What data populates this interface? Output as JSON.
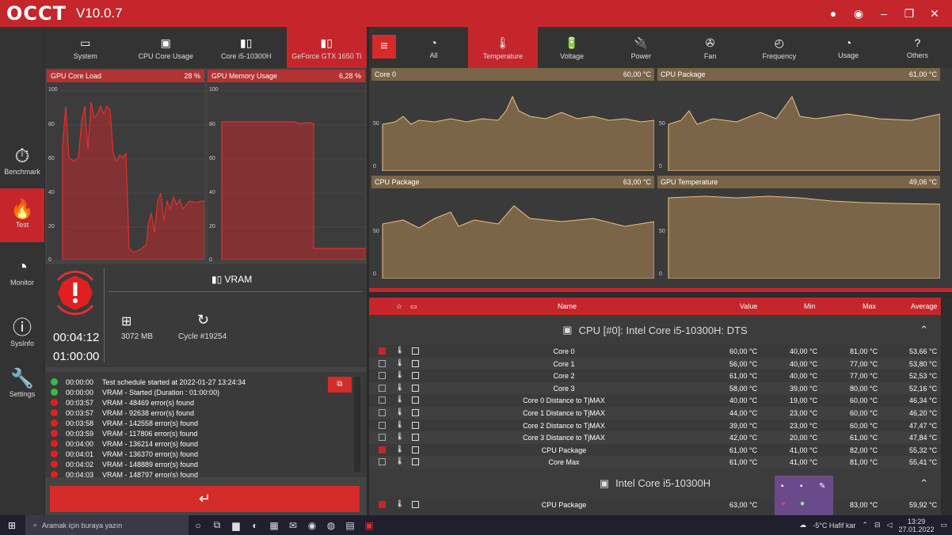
{
  "app": {
    "logo": "OCCT",
    "version": "V10.0.7"
  },
  "window_controls": {
    "info": "●",
    "camera": "◉",
    "minimize": "–",
    "maximize": "❐",
    "close": "✕"
  },
  "nav": [
    {
      "label": "Benchmark",
      "icon": "stopwatch-icon"
    },
    {
      "label": "Test",
      "icon": "flame-icon"
    },
    {
      "label": "Monitor",
      "icon": "gauge-icon"
    },
    {
      "label": "SysInfo",
      "icon": "info-icon"
    },
    {
      "label": "Settings",
      "icon": "wrench-icon"
    }
  ],
  "device_tabs": [
    {
      "label": "System"
    },
    {
      "label": "CPU Core Usage"
    },
    {
      "label": "Core i5-10300H"
    },
    {
      "label": "GeForce GTX 1650 Ti"
    }
  ],
  "gpu_charts": {
    "core_load": {
      "title": "GPU Core Load",
      "value": "28 %",
      "yticks": [
        "100",
        "80",
        "60",
        "40",
        "20",
        "0"
      ]
    },
    "mem_usage": {
      "title": "GPU Memory Usage",
      "value": "6,28 %",
      "yticks": [
        "100",
        "80",
        "60",
        "40",
        "20",
        "0"
      ]
    }
  },
  "test": {
    "elapsed": "00:04:12",
    "duration": "01:00:00",
    "name": "VRAM",
    "memory": "3072 MB",
    "cycle": "Cycle #19254"
  },
  "log": [
    {
      "time": "00:00:00",
      "msg": "Test schedule started at 2022-01-27 13:24:34",
      "status": "ok"
    },
    {
      "time": "00:00:00",
      "msg": "VRAM - Started (Duration : 01:00:00)",
      "status": "ok"
    },
    {
      "time": "00:03:57",
      "msg": "VRAM - 48469 error(s) found",
      "status": "err"
    },
    {
      "time": "00:03:57",
      "msg": "VRAM - 92638 error(s) found",
      "status": "err"
    },
    {
      "time": "00:03:58",
      "msg": "VRAM - 142558 error(s) found",
      "status": "err"
    },
    {
      "time": "00:03:59",
      "msg": "VRAM - 117806 error(s) found",
      "status": "err"
    },
    {
      "time": "00:04:00",
      "msg": "VRAM - 136214 error(s) found",
      "status": "err"
    },
    {
      "time": "00:04:01",
      "msg": "VRAM - 136370 error(s) found",
      "status": "err"
    },
    {
      "time": "00:04:02",
      "msg": "VRAM - 148889 error(s) found",
      "status": "err"
    },
    {
      "time": "00:04:03",
      "msg": "VRAM - 148797 error(s) found",
      "status": "err"
    }
  ],
  "start_button": "↵",
  "sensor_tabs": [
    {
      "label": "All"
    },
    {
      "label": "Temperature"
    },
    {
      "label": "Voltage"
    },
    {
      "label": "Power"
    },
    {
      "label": "Fan"
    },
    {
      "label": "Frequency"
    },
    {
      "label": "Usage"
    },
    {
      "label": "Others"
    }
  ],
  "temp_charts": [
    {
      "title": "Core 0",
      "value": "60,00 °C",
      "yticks": [
        "50",
        "0"
      ]
    },
    {
      "title": "CPU Package",
      "value": "61,00 °C",
      "yticks": [
        "50",
        "0"
      ]
    },
    {
      "title": "CPU Package",
      "value": "63,00 °C",
      "yticks": [
        "50",
        "0"
      ]
    },
    {
      "title": "GPU Temperature",
      "value": "49,06 °C",
      "yticks": [
        "50",
        "0"
      ]
    }
  ],
  "table": {
    "headers": {
      "name": "Name",
      "value": "Value",
      "min": "Min",
      "max": "Max",
      "avg": "Average"
    },
    "group1": "CPU [#0]: Intel Core i5-10300H: DTS",
    "rows": [
      {
        "name": "Core 0",
        "value": "60,00 °C",
        "min": "40,00 °C",
        "max": "81,00 °C",
        "avg": "53,66 °C",
        "checked": true
      },
      {
        "name": "Core 1",
        "value": "56,00 °C",
        "min": "40,00 °C",
        "max": "77,00 °C",
        "avg": "53,80 °C",
        "checked": false
      },
      {
        "name": "Core 2",
        "value": "61,00 °C",
        "min": "40,00 °C",
        "max": "77,00 °C",
        "avg": "52,53 °C",
        "checked": false
      },
      {
        "name": "Core 3",
        "value": "58,00 °C",
        "min": "39,00 °C",
        "max": "80,00 °C",
        "avg": "52,16 °C",
        "checked": false
      },
      {
        "name": "Core 0 Distance to TjMAX",
        "value": "40,00 °C",
        "min": "19,00 °C",
        "max": "60,00 °C",
        "avg": "46,34 °C",
        "checked": false
      },
      {
        "name": "Core 1 Distance to TjMAX",
        "value": "44,00 °C",
        "min": "23,00 °C",
        "max": "60,00 °C",
        "avg": "46,20 °C",
        "checked": false
      },
      {
        "name": "Core 2 Distance to TjMAX",
        "value": "39,00 °C",
        "min": "23,00 °C",
        "max": "60,00 °C",
        "avg": "47,47 °C",
        "checked": false
      },
      {
        "name": "Core 3 Distance to TjMAX",
        "value": "42,00 °C",
        "min": "20,00 °C",
        "max": "61,00 °C",
        "avg": "47,84 °C",
        "checked": false
      },
      {
        "name": "CPU Package",
        "value": "61,00 °C",
        "min": "41,00 °C",
        "max": "82,00 °C",
        "avg": "55,32 °C",
        "checked": true
      },
      {
        "name": "Core Max",
        "value": "61,00 °C",
        "min": "41,00 °C",
        "max": "81,00 °C",
        "avg": "55,41 °C",
        "checked": false
      }
    ],
    "group2": "Intel Core i5-10300H",
    "rows2": [
      {
        "name": "CPU Package",
        "value": "63,00 °C",
        "min": "",
        "max": "83,00 °C",
        "avg": "59,92 °C",
        "checked": true
      }
    ]
  },
  "taskbar": {
    "search": "Aramak için buraya yazın",
    "weather": "-5°C  Hafif kar",
    "time": "13:29",
    "date": "27.01.2022"
  }
}
